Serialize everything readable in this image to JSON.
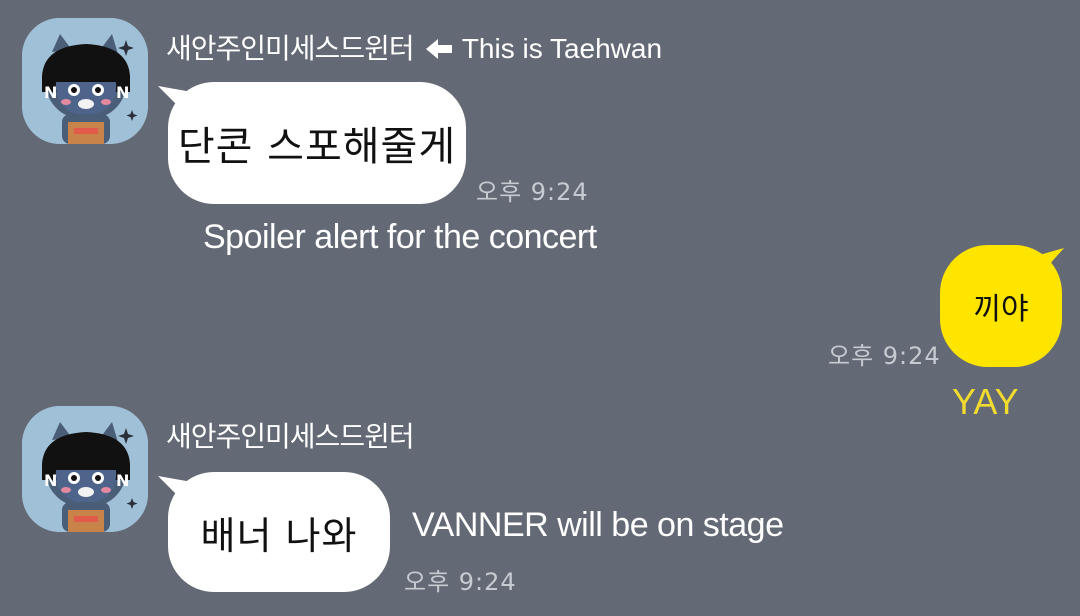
{
  "chat": {
    "messages": [
      {
        "sender": "새안주인미세스드윈터",
        "note": "This is Taehwan",
        "text": "단콘 스포해줄게",
        "time": "오후 9:24",
        "caption": "Spoiler alert for the concert"
      },
      {
        "text": "끼야",
        "time": "오후 9:24",
        "caption": "YAY"
      },
      {
        "sender": "새안주인미세스드윈터",
        "text": "배너 나와",
        "time": "오후 9:24",
        "caption": "VANNER will be on stage"
      }
    ]
  },
  "colors": {
    "background": "#646a75",
    "incoming_bubble": "#ffffff",
    "outgoing_bubble": "#fee500",
    "time_text": "#c6cad1",
    "caption_yay": "#f0db2e"
  },
  "icons": {
    "avatar": "character-avatar-icon",
    "arrow": "left-arrow-icon"
  }
}
